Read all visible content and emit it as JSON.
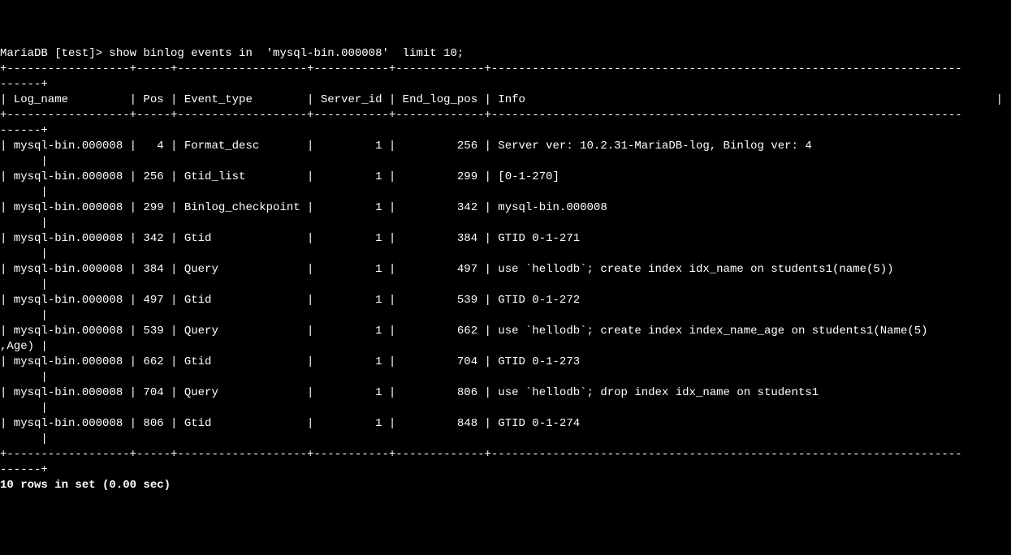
{
  "prompt": "MariaDB [test]> show binlog events in  'mysql-bin.000008'  limit 10;",
  "sep_top": "+------------------+-----+-------------------+-----------+-------------+---------------------------------------------------------------------",
  "sep_tail": "------+",
  "header_line": "| Log_name         | Pos | Event_type        | Server_id | End_log_pos | Info                                                                     |",
  "rows": [
    {
      "log": "mysql-bin.000008",
      "pos": "  4",
      "etype": "Format_desc      ",
      "sid": "        1",
      "elp": "        256",
      "info": "Server ver: 10.2.31-MariaDB-log, Binlog ver: 4                       "
    },
    {
      "log": "mysql-bin.000008",
      "pos": "256",
      "etype": "Gtid_list        ",
      "sid": "        1",
      "elp": "        299",
      "info": "[0-1-270]                                                            "
    },
    {
      "log": "mysql-bin.000008",
      "pos": "299",
      "etype": "Binlog_checkpoint",
      "sid": "        1",
      "elp": "        342",
      "info": "mysql-bin.000008                                                     "
    },
    {
      "log": "mysql-bin.000008",
      "pos": "342",
      "etype": "Gtid             ",
      "sid": "        1",
      "elp": "        384",
      "info": "GTID 0-1-271                                                         "
    },
    {
      "log": "mysql-bin.000008",
      "pos": "384",
      "etype": "Query            ",
      "sid": "        1",
      "elp": "        497",
      "info": "use `hellodb`; create index idx_name on students1(name(5))           "
    },
    {
      "log": "mysql-bin.000008",
      "pos": "497",
      "etype": "Gtid             ",
      "sid": "        1",
      "elp": "        539",
      "info": "GTID 0-1-272                                                         "
    },
    {
      "log": "mysql-bin.000008",
      "pos": "539",
      "etype": "Query            ",
      "sid": "        1",
      "elp": "        662",
      "info": "use `hellodb`; create index index_name_age on students1(Name(5)\n,Age) |"
    },
    {
      "log": "mysql-bin.000008",
      "pos": "662",
      "etype": "Gtid             ",
      "sid": "        1",
      "elp": "        704",
      "info": "GTID 0-1-273                                                         "
    },
    {
      "log": "mysql-bin.000008",
      "pos": "704",
      "etype": "Query            ",
      "sid": "        1",
      "elp": "        806",
      "info": "use `hellodb`; drop index idx_name on students1                      "
    },
    {
      "log": "mysql-bin.000008",
      "pos": "806",
      "etype": "Gtid             ",
      "sid": "        1",
      "elp": "        848",
      "info": "GTID 0-1-274                                                         "
    }
  ],
  "footer": "10 rows in set (0.00 sec)",
  "chart_data": {
    "type": "table",
    "columns": [
      "Log_name",
      "Pos",
      "Event_type",
      "Server_id",
      "End_log_pos",
      "Info"
    ],
    "rows": [
      [
        "mysql-bin.000008",
        4,
        "Format_desc",
        1,
        256,
        "Server ver: 10.2.31-MariaDB-log, Binlog ver: 4"
      ],
      [
        "mysql-bin.000008",
        256,
        "Gtid_list",
        1,
        299,
        "[0-1-270]"
      ],
      [
        "mysql-bin.000008",
        299,
        "Binlog_checkpoint",
        1,
        342,
        "mysql-bin.000008"
      ],
      [
        "mysql-bin.000008",
        342,
        "Gtid",
        1,
        384,
        "GTID 0-1-271"
      ],
      [
        "mysql-bin.000008",
        384,
        "Query",
        1,
        497,
        "use `hellodb`; create index idx_name on students1(name(5))"
      ],
      [
        "mysql-bin.000008",
        497,
        "Gtid",
        1,
        539,
        "GTID 0-1-272"
      ],
      [
        "mysql-bin.000008",
        539,
        "Query",
        1,
        662,
        "use `hellodb`; create index index_name_age on students1(Name(5),Age)"
      ],
      [
        "mysql-bin.000008",
        662,
        "Gtid",
        1,
        704,
        "GTID 0-1-273"
      ],
      [
        "mysql-bin.000008",
        704,
        "Query",
        1,
        806,
        "use `hellodb`; drop index idx_name on students1"
      ],
      [
        "mysql-bin.000008",
        806,
        "Gtid",
        1,
        848,
        "GTID 0-1-274"
      ]
    ]
  }
}
